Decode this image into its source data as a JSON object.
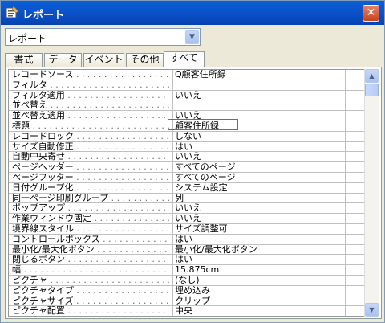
{
  "window": {
    "title": "レポート",
    "close_label": "✕"
  },
  "object_selector": {
    "value": "レポート"
  },
  "tabs": [
    {
      "label": "書式"
    },
    {
      "label": "データ"
    },
    {
      "label": "イベント"
    },
    {
      "label": "その他"
    },
    {
      "label": "すべて"
    }
  ],
  "properties": [
    {
      "label": "レコードソース",
      "value": "Q顧客住所録"
    },
    {
      "label": "フィルタ",
      "value": ""
    },
    {
      "label": "フィルタ適用",
      "value": "いいえ"
    },
    {
      "label": "並べ替え",
      "value": ""
    },
    {
      "label": "並べ替え適用",
      "value": "いいえ"
    },
    {
      "label": "標題",
      "value": "顧客住所録"
    },
    {
      "label": "レコードロック",
      "value": "しない"
    },
    {
      "label": "サイズ自動修正",
      "value": "はい"
    },
    {
      "label": "自動中央寄せ",
      "value": "いいえ"
    },
    {
      "label": "ページヘッダー",
      "value": "すべてのページ"
    },
    {
      "label": "ページフッター",
      "value": "すべてのページ"
    },
    {
      "label": "日付グループ化",
      "value": "システム設定"
    },
    {
      "label": "同一ページ印刷グループ",
      "value": "列"
    },
    {
      "label": "ポップアップ",
      "value": "いいえ"
    },
    {
      "label": "作業ウィンドウ固定",
      "value": "いいえ"
    },
    {
      "label": "境界線スタイル",
      "value": "サイズ調整可"
    },
    {
      "label": "コントロールボックス",
      "value": "はい"
    },
    {
      "label": "最小化/最大化ボタン",
      "value": "最小化/最大化ボタン"
    },
    {
      "label": "閉じるボタン",
      "value": "はい"
    },
    {
      "label": "幅",
      "value": "15.875cm"
    },
    {
      "label": "ピクチャ",
      "value": "(なし)"
    },
    {
      "label": "ピクチャタイプ",
      "value": "埋め込み"
    },
    {
      "label": "ピクチャサイズ",
      "value": "クリップ"
    },
    {
      "label": "ピクチャ配置",
      "value": "中央"
    }
  ]
}
